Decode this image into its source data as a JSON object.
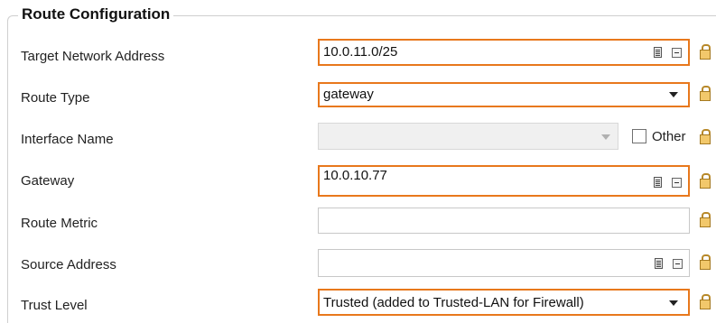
{
  "section": {
    "title": "Route Configuration"
  },
  "rows": {
    "target_network": {
      "label": "Target Network Address",
      "value": "10.0.11.0/25"
    },
    "route_type": {
      "label": "Route Type",
      "value": "gateway"
    },
    "interface_name": {
      "label": "Interface Name",
      "value": "",
      "other_label": "Other",
      "other_checked": false
    },
    "gateway": {
      "label": "Gateway",
      "value": "10.0.10.77"
    },
    "route_metric": {
      "label": "Route Metric",
      "value": ""
    },
    "source_address": {
      "label": "Source Address",
      "value": ""
    },
    "trust_level": {
      "label": "Trust Level",
      "value": "Trusted (added to Trusted-LAN for Firewall)"
    }
  },
  "colors": {
    "highlight_border": "#e8781c",
    "lock": "#f2c86b"
  },
  "icons": [
    "doc-icon",
    "minus-icon",
    "dropdown-arrow-icon",
    "lock-icon"
  ]
}
